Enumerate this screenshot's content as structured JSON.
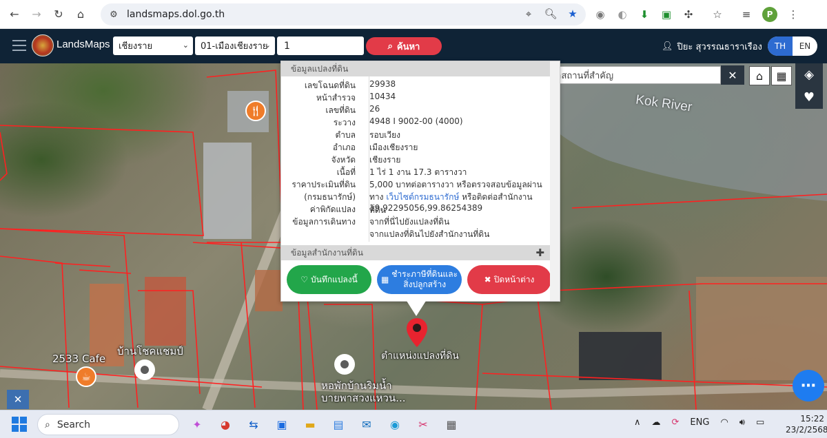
{
  "browser": {
    "url": "landsmaps.dol.go.th",
    "profile_initial": "P"
  },
  "header": {
    "brand": "LandsMaps",
    "province": "เชียงราย",
    "district": "01-เมืองเชียงราย",
    "parcel_value": "1",
    "search_label": "ค้นหา",
    "user_name": "ปิยะ สุวรรณธาราเรือง",
    "lang_th": "TH",
    "lang_en": "EN"
  },
  "map": {
    "river_label": "Kok River",
    "label_cafe": "2533 Cafe",
    "label_village": "บ้านโชคแชมป์",
    "label_marker": "ตำแหน่งแปลงที่ดิน",
    "label_dorm_1": "หอพักบ้านริมน้ำ",
    "label_dorm_2": "บายพาสวงแหวน...",
    "landmark_placeholder": "ค้นหาสถานที่สำคัญ"
  },
  "popup": {
    "section_land": "ข้อมูลแปลงที่ดิน",
    "rows": [
      {
        "label": "เลขโฉนดที่ดิน",
        "value": "29938"
      },
      {
        "label": "หน้าสำรวจ",
        "value": "10434"
      },
      {
        "label": "เลขที่ดิน",
        "value": "26"
      },
      {
        "label": "ระวาง",
        "value": "4948 I 9002-00 (4000)"
      },
      {
        "label": "ตำบล",
        "value": "รอบเวียง"
      },
      {
        "label": "อำเภอ",
        "value": "เมืองเชียงราย"
      },
      {
        "label": "จังหวัด",
        "value": "เชียงราย"
      },
      {
        "label": "เนื้อที่",
        "value": "1 ไร่ 1 งาน 17.3 ตารางวา"
      },
      {
        "label": "ราคาประเมินที่ดิน",
        "value": "5,000 บาทต่อตารางวา หรือตรวจสอบข้อมูลผ่าน"
      },
      {
        "label": "(กรมธนารักษ์)",
        "value_prefix": "ทาง ",
        "value_link": "เว็บไซต์กรมธนารักษ์",
        "value_suffix": " หรือติดต่อสำนักงานที่ดิน"
      },
      {
        "label": "ค่าพิกัดแปลง",
        "value": "19.92295056,99.86254389"
      },
      {
        "label": "ข้อมูลการเดินทาง",
        "value": "จากที่นี่ไปยังแปลงที่ดิน"
      },
      {
        "label": "",
        "value": "จากแปลงที่ดินไปยังสำนักงานที่ดิน"
      }
    ],
    "section_office": "ข้อมูลสำนักงานที่ดิน",
    "btn_save": "บันทึกแปลงนี้",
    "btn_tax_1": "ชำระภาษีที่ดินและ",
    "btn_tax_2": "สิ่งปลูกสร้าง",
    "btn_close": "ปิดหน้าต่าง"
  },
  "taskbar": {
    "search": "Search",
    "lang": "ENG",
    "time": "15:22",
    "date": "23/2/2568"
  }
}
